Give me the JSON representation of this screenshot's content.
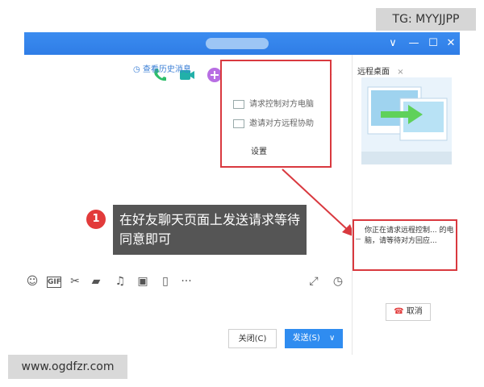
{
  "watermarks": {
    "top": "TG: MYYJJPP",
    "bottom": "www.ogdfzr.com"
  },
  "window": {
    "controls": {
      "collapse": "∨",
      "minimize": "—",
      "maximize": "☐",
      "close": "✕"
    }
  },
  "chat": {
    "history_label": "查看历史消息",
    "popup": {
      "items": [
        "请求控制对方电脑",
        "邀请对方远程协助"
      ],
      "settings_label": "设置"
    },
    "callout": {
      "number": "1",
      "text": "在好友聊天页面上发送请求等待同意即可"
    },
    "buttons": {
      "close": "关闭(C)",
      "send": "发送(S)",
      "send_menu": "∨"
    }
  },
  "remote_panel": {
    "title": "远程桌面",
    "close": "×",
    "status_text": "你正在请求远程控制... 的电脑，请等待对方回应...",
    "cancel_label": "取消"
  },
  "colors": {
    "titlebar": "#2f7de6",
    "highlight": "#d9393f",
    "send_button": "#2f8cf0",
    "callout_bg": "#555555",
    "badge": "#e23b3b"
  }
}
